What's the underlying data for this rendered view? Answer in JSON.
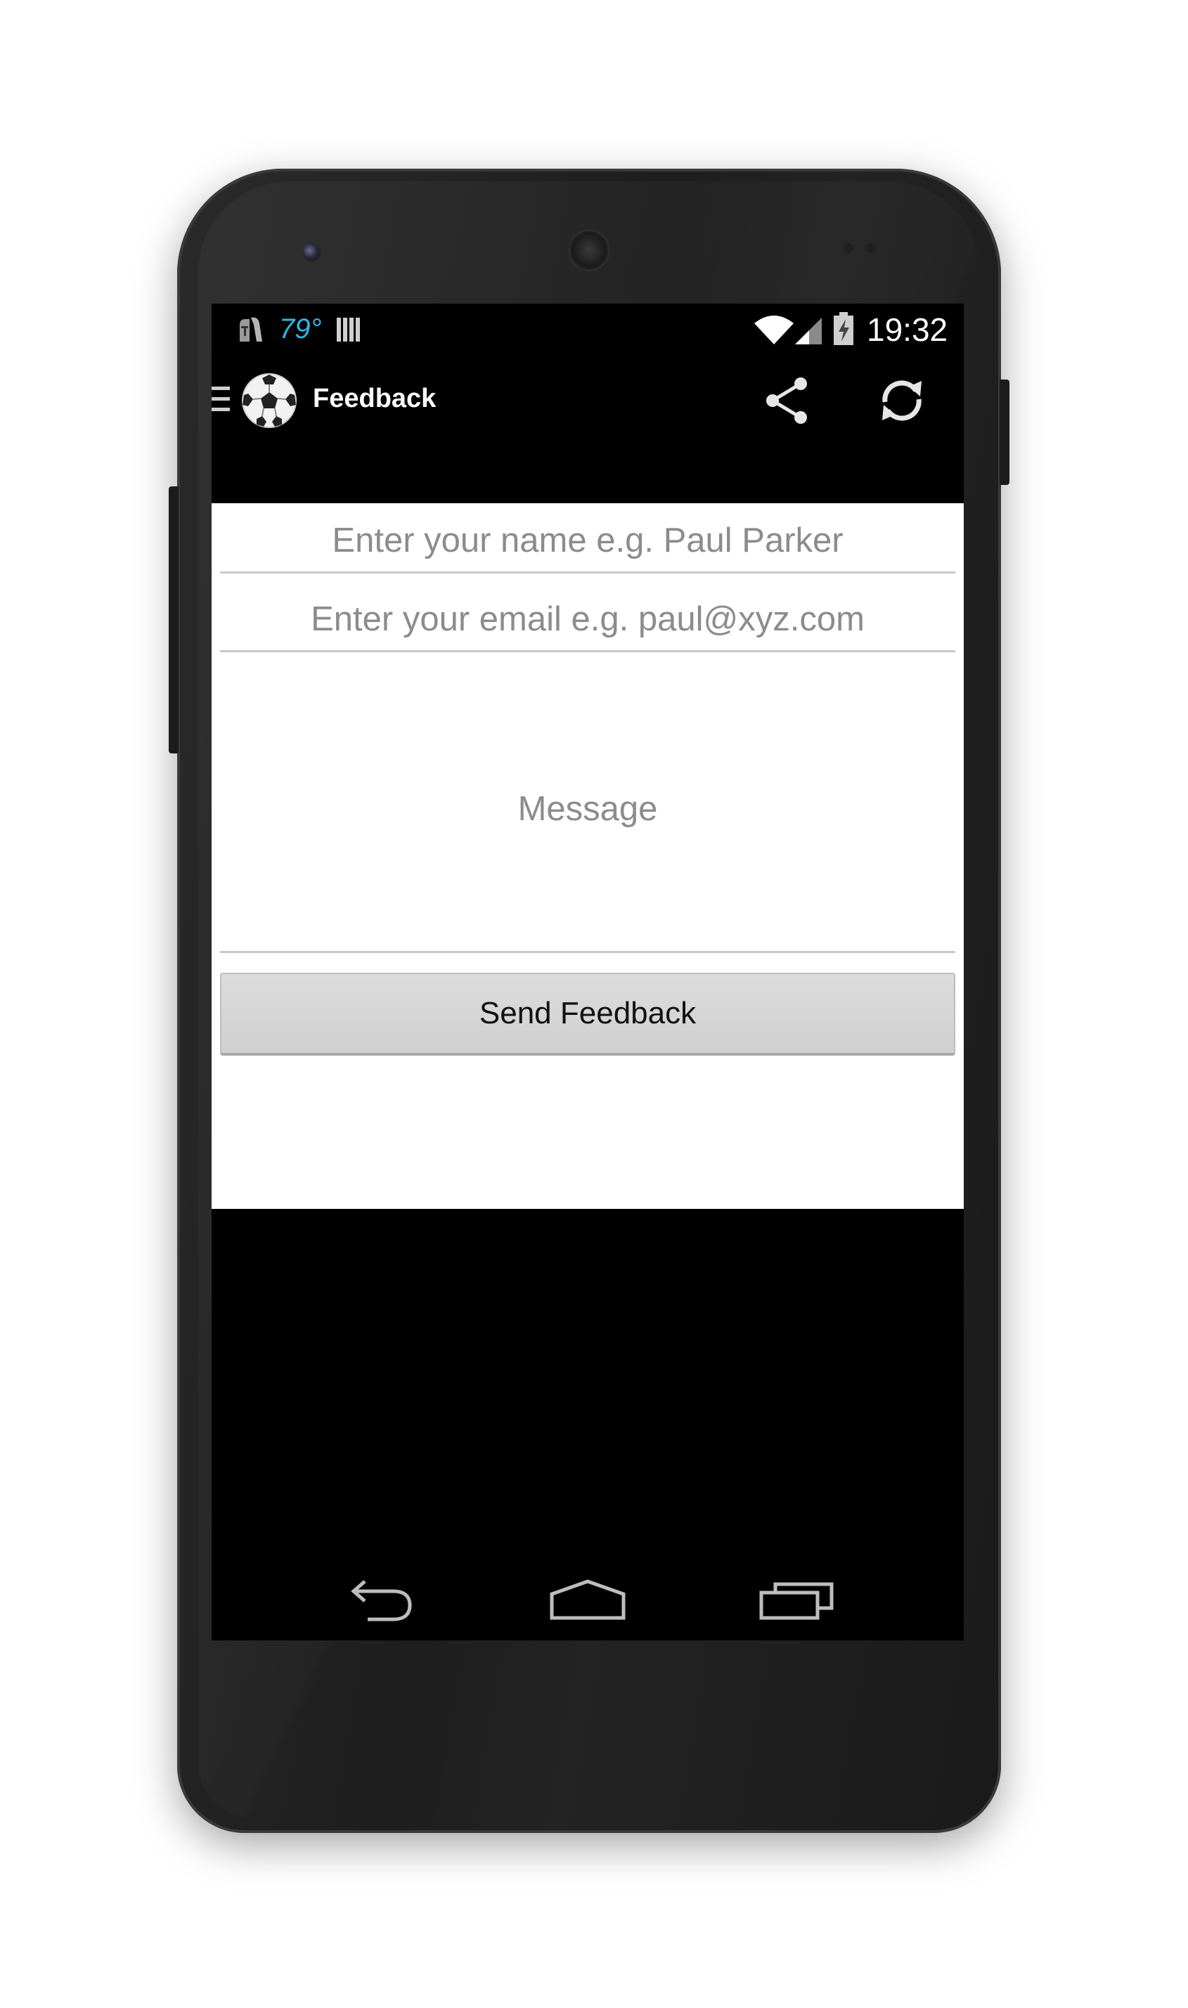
{
  "status_bar": {
    "temperature": "79°",
    "time": "19:32",
    "icons": [
      "carrier-icon",
      "bars-icon",
      "wifi-icon",
      "cell-signal-icon",
      "battery-charging-icon"
    ]
  },
  "action_bar": {
    "title": "Feedback",
    "icons": [
      "drawer-indicator-icon",
      "soccer-ball-logo-icon",
      "share-icon",
      "refresh-icon"
    ]
  },
  "form": {
    "name_placeholder": "Enter your name e.g. Paul Parker",
    "email_placeholder": "Enter your email e.g. paul@xyz.com",
    "message_placeholder": "Message",
    "send_label": "Send Feedback"
  },
  "nav_bar": {
    "icons": [
      "back-icon",
      "home-icon",
      "recent-apps-icon"
    ]
  },
  "colors": {
    "screen_background": "#000000",
    "form_background": "#ffffff",
    "temperature_text": "#33b5e5",
    "button_background": "#d6d6d6",
    "placeholder_text": "#8c8c8c"
  }
}
